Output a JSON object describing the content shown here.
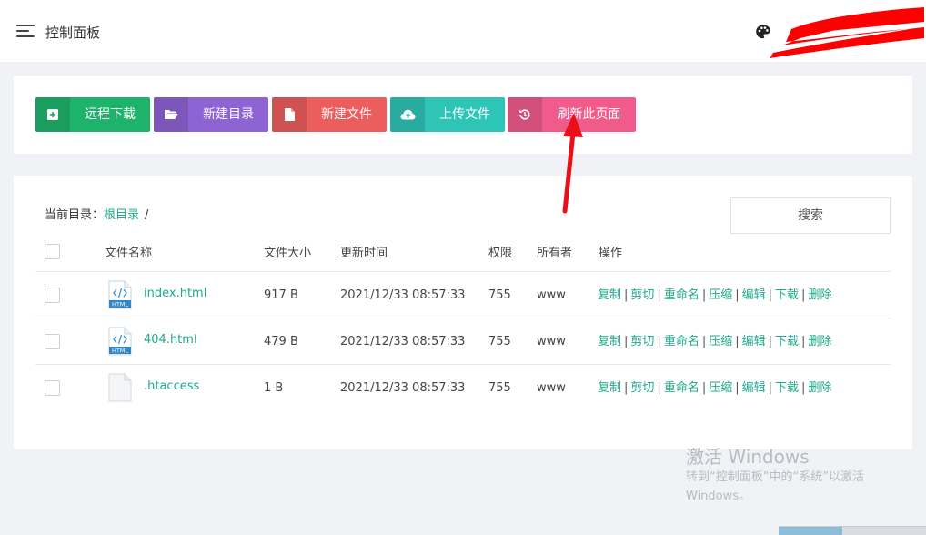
{
  "header": {
    "title": "控制面板",
    "menu_icon": "hamburger-menu-icon",
    "theme_icon": "palette-icon"
  },
  "toolbar": {
    "buttons": [
      {
        "label": "远程下载",
        "icon": "plus-square-icon",
        "color": "#1eb36a"
      },
      {
        "label": "新建目录",
        "icon": "folder-open-icon",
        "color": "#8e63d3"
      },
      {
        "label": "新建文件",
        "icon": "file-icon",
        "color": "#ec5e5e"
      },
      {
        "label": "上传文件",
        "icon": "cloud-upload-icon",
        "color": "#2ec4b6"
      },
      {
        "label": "刷新此页面",
        "icon": "history-icon",
        "color": "#f05b8c"
      }
    ]
  },
  "breadcrumb": {
    "prefix": "当前目录：",
    "root": "根目录",
    "sep": "/"
  },
  "search": {
    "label": "搜索"
  },
  "table": {
    "columns": [
      "文件名称",
      "文件大小",
      "更新时间",
      "权限",
      "所有者",
      "操作"
    ],
    "rows": [
      {
        "name": "index.html",
        "type": "html",
        "size": "917 B",
        "mtime": "2021/12/33 08:57:33",
        "perm": "755",
        "owner": "www"
      },
      {
        "name": "404.html",
        "type": "html",
        "size": "479 B",
        "mtime": "2021/12/33 08:57:33",
        "perm": "755",
        "owner": "www"
      },
      {
        "name": ".htaccess",
        "type": "blank",
        "size": "1 B",
        "mtime": "2021/12/33 08:57:33",
        "perm": "755",
        "owner": "www"
      }
    ],
    "actions": [
      "复制",
      "剪切",
      "重命名",
      "压缩",
      "编辑",
      "下载",
      "删除"
    ],
    "action_sep": "|",
    "html_badge": "HTML"
  },
  "watermark": {
    "title": "激活 Windows",
    "line1": "转到“控制面板”中的“系统”以激活",
    "line2": "Windows。"
  },
  "colors": {
    "accent": "#1eaa8c",
    "annotation_arrow": "#e8101a",
    "redaction": "#ff0000"
  }
}
